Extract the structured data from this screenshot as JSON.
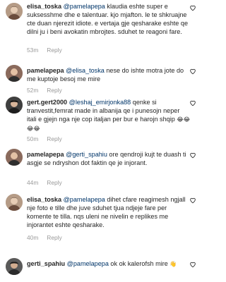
{
  "comments": [
    {
      "username": "elisa_toska",
      "mention": "@pamelapepa",
      "text": " klaudia eshte super e suksesshme dhe e talentuar. kjo mjafton. le te shkruajne cte duan njerezit idiote. e vertaja gje qesharake eshte qe dilni ju i beni avokatin mbrojtes. sduhet te reagoni fare.",
      "time": "53m",
      "reply": "Reply",
      "avatar_color": "#b59b86"
    },
    {
      "username": "pamelapepa",
      "mention": "@elisa_toska",
      "text": " nese do ishte motra jote do me kuptoje besoj me mire",
      "time": "52m",
      "reply": "Reply",
      "avatar_color": "#8a6a5c"
    },
    {
      "username": "gert.gert2000",
      "mention": "@leshaj_emirjonka88",
      "text": " qenke si tranvestit,femrat made in albanija qe i punesojn neper itali e gjejn nga nje cop italjan per bur e harojn shqip",
      "emoji": "😂😂😂😂",
      "time": "50m",
      "reply": "Reply",
      "avatar_color": "#3f3f3f"
    },
    {
      "username": "pamelapepa",
      "mention": "@gerti_spahiu",
      "text": " ore qendroji kujt te duash ti asgje se ndryshon dot faktin qe je injorant.",
      "time": "44m",
      "reply": "Reply",
      "avatar_color": "#8a6a5c"
    },
    {
      "username": "elisa_toska",
      "mention": "@pamelapepa",
      "text": " dihet cfare reagimesh ngjall nje foto e tille dhe juve sduhet tjua ndjeje fare per komente te tilla. nqs uleni ne nivelin e replikes me injorantet eshte qesharake.",
      "time": "40m",
      "reply": "Reply",
      "avatar_color": "#b59b86"
    },
    {
      "username": "gerti_spahiu",
      "mention": "@pamelapepa",
      "text": " ok ok kalerofsh mire",
      "emoji": "👋",
      "time": "",
      "reply": "",
      "avatar_color": "#5a5a5a"
    }
  ],
  "colors": {
    "mention": "#003569",
    "meta": "#999999",
    "text": "#262626"
  },
  "icons": [
    "heart-outline-icon"
  ]
}
